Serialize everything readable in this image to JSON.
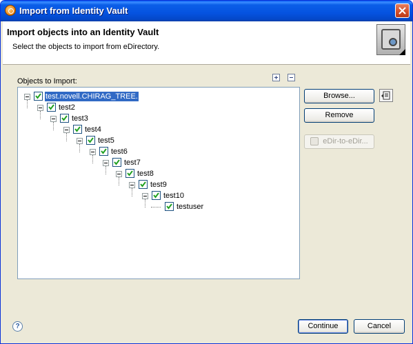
{
  "window": {
    "title": "Import from Identity Vault"
  },
  "header": {
    "title": "Import objects into an Identity Vault",
    "description": "Select the objects to import from eDirectory."
  },
  "objects": {
    "label": "Objects to Import:"
  },
  "tree": {
    "nodes": [
      {
        "label": "test.novell.CHIRAG_TREE.",
        "checked": true,
        "selected": true,
        "expanded": true
      },
      {
        "label": "test2",
        "checked": true,
        "expanded": true
      },
      {
        "label": "test3",
        "checked": true,
        "expanded": true
      },
      {
        "label": "test4",
        "checked": true,
        "expanded": true
      },
      {
        "label": "test5",
        "checked": true,
        "expanded": true
      },
      {
        "label": "test6",
        "checked": true,
        "expanded": true
      },
      {
        "label": "test7",
        "checked": true,
        "expanded": true
      },
      {
        "label": "test8",
        "checked": true,
        "expanded": true
      },
      {
        "label": "test9",
        "checked": true,
        "expanded": true
      },
      {
        "label": "test10",
        "checked": true,
        "expanded": true
      },
      {
        "label": "testuser",
        "checked": true,
        "expanded": false
      }
    ]
  },
  "buttons": {
    "browse": "Browse...",
    "remove": "Remove",
    "edir": "eDir-to-eDir...",
    "continue": "Continue",
    "cancel": "Cancel"
  },
  "help": {
    "glyph": "?"
  },
  "colors": {
    "title_bar": "#0553e0",
    "selection": "#316ac5",
    "check": "#21a121"
  }
}
